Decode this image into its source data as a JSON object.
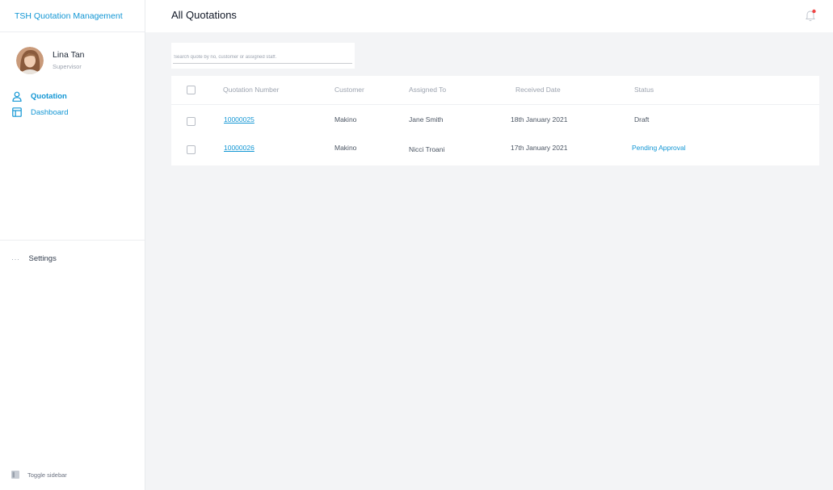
{
  "app": {
    "title": "TSH Quotation Management"
  },
  "user": {
    "name": "Lina Tan",
    "role": "Supervisor"
  },
  "nav": [
    {
      "label": "Quotation",
      "icon": "user-icon",
      "active": true
    },
    {
      "label": "Dashboard",
      "icon": "layout-icon",
      "active": false
    }
  ],
  "settings": {
    "label": "Settings",
    "icon": "more-dots-icon"
  },
  "toggle_sidebar": {
    "label": "Toggle sidebar"
  },
  "header": {
    "title": "All Quotations",
    "notification_dot": true
  },
  "search": {
    "placeholder": "Search quote by no, customer or assigned staff.",
    "value": ""
  },
  "table": {
    "columns": [
      "Quotation Number",
      "Customer",
      "Assigned To",
      "Received Date",
      "Status"
    ],
    "rows": [
      {
        "number": "10000025",
        "customer": "Makino",
        "assigned": "Jane Smith",
        "date": "18th January 2021",
        "status": "Draft"
      },
      {
        "number": "10000026",
        "customer": "Makino",
        "assigned": "Nicci Troani",
        "date": "17th January 2021",
        "status": "Pending Approval"
      }
    ]
  },
  "colors": {
    "accent": "#1296d4",
    "background": "#f3f4f6",
    "notification": "#ef4444"
  }
}
